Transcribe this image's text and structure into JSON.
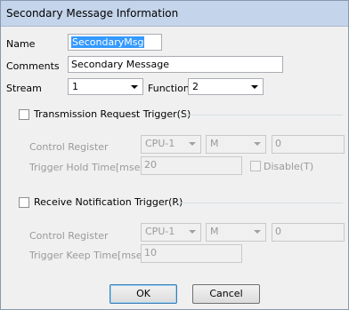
{
  "window": {
    "title": "Secondary Message Information"
  },
  "fields": {
    "name": {
      "label": "Name",
      "value": "SecondaryMsg"
    },
    "comments": {
      "label": "Comments",
      "value": "Secondary Message"
    },
    "stream": {
      "label": "Stream",
      "value": "1"
    },
    "function": {
      "label": "Function",
      "value": "2"
    }
  },
  "transmission": {
    "checkbox_label": "Transmission Request Trigger(S)",
    "checked": false,
    "control_register_label": "Control Register",
    "cpu": "CPU-1",
    "device": "M",
    "address": "0",
    "hold_time_label": "Trigger Hold Time[msec]",
    "hold_time_value": "20",
    "disable_label": "Disable(T)"
  },
  "receive": {
    "checkbox_label": "Receive Notification Trigger(R)",
    "checked": false,
    "control_register_label": "Control Register",
    "cpu": "CPU-1",
    "device": "M",
    "address": "0",
    "keep_time_label": "Trigger Keep Time[msec]",
    "keep_time_value": "10"
  },
  "buttons": {
    "ok": "OK",
    "cancel": "Cancel"
  }
}
